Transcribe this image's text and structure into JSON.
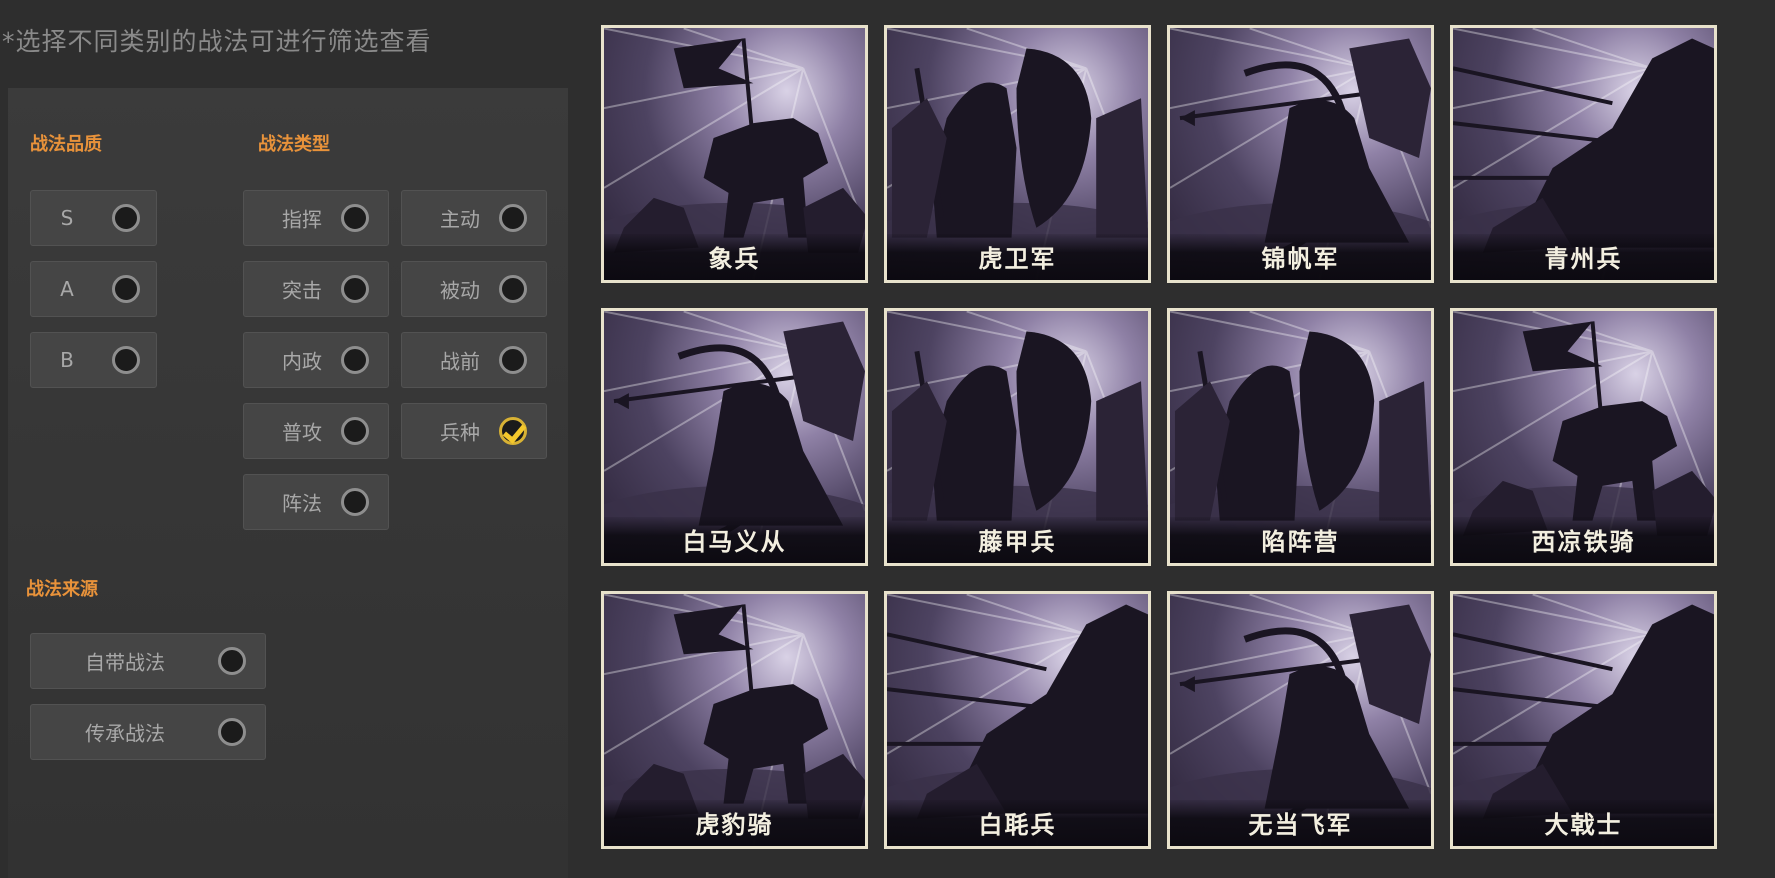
{
  "hint": "*选择不同类别的战法可进行筛选查看",
  "filters": {
    "quality": {
      "title": "战法品质",
      "options": [
        {
          "label": "S",
          "checked": false
        },
        {
          "label": "A",
          "checked": false
        },
        {
          "label": "B",
          "checked": false
        }
      ]
    },
    "type": {
      "title": "战法类型",
      "options": [
        {
          "label": "指挥",
          "checked": false
        },
        {
          "label": "主动",
          "checked": false
        },
        {
          "label": "突击",
          "checked": false
        },
        {
          "label": "被动",
          "checked": false
        },
        {
          "label": "内政",
          "checked": false
        },
        {
          "label": "战前",
          "checked": false
        },
        {
          "label": "普攻",
          "checked": false
        },
        {
          "label": "兵种",
          "checked": true
        },
        {
          "label": "阵法",
          "checked": false
        }
      ]
    },
    "source": {
      "title": "战法来源",
      "options": [
        {
          "label": "自带战法",
          "checked": false
        },
        {
          "label": "传承战法",
          "checked": false
        }
      ]
    }
  },
  "cards": [
    {
      "name": "象兵",
      "art": "flag-rider-icon"
    },
    {
      "name": "虎卫军",
      "art": "shield-warrior-icon"
    },
    {
      "name": "锦帆军",
      "art": "archer-icon"
    },
    {
      "name": "青州兵",
      "art": "spear-charge-icon"
    },
    {
      "name": "白马义从",
      "art": "archer-icon"
    },
    {
      "name": "藤甲兵",
      "art": "shield-warrior-icon"
    },
    {
      "name": "陷阵营",
      "art": "shield-warrior-icon"
    },
    {
      "name": "西凉铁骑",
      "art": "flag-rider-icon"
    },
    {
      "name": "虎豹骑",
      "art": "flag-rider-icon"
    },
    {
      "name": "白毦兵",
      "art": "spear-charge-icon"
    },
    {
      "name": "无当飞军",
      "art": "archer-icon"
    },
    {
      "name": "大戟士",
      "art": "spear-charge-icon"
    }
  ]
}
